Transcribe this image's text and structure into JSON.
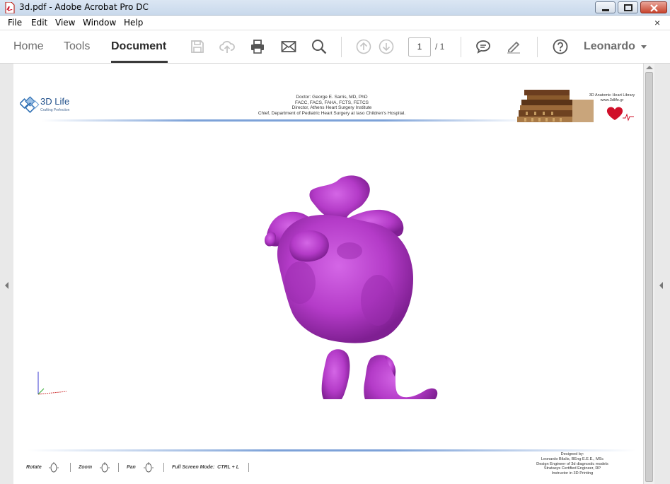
{
  "window": {
    "title": "3d.pdf - Adobe Acrobat Pro DC"
  },
  "menubar": {
    "items": [
      "File",
      "Edit",
      "View",
      "Window",
      "Help"
    ],
    "close_glyph": "×"
  },
  "toolbar": {
    "tabs": [
      {
        "label": "Home",
        "active": false
      },
      {
        "label": "Tools",
        "active": false
      },
      {
        "label": "Document",
        "active": true
      }
    ],
    "page_current": "1",
    "page_total": "/ 1",
    "user_name": "Leonardo",
    "icons": [
      "save-icon",
      "upload-icon",
      "print-icon",
      "email-icon",
      "search-icon",
      "page-up-icon",
      "page-down-icon",
      "comment-icon",
      "sign-icon",
      "help-icon"
    ]
  },
  "document": {
    "logo_text": "3D Life",
    "logo_tagline": "Crafting Perfection",
    "doctor_lines": [
      "Doctor: George E. Sarris, MD, PhD",
      "FACC, FACS, FAHA, FCTS, FETCS",
      "Director, Athens Heart Surgery Institute",
      "Chief, Department of Pediatric Heart Surgery at Iaso Children's Hospital."
    ],
    "library_title": "3D Anatomic Heart Library",
    "library_url": "www.3dlife.gr",
    "model_color": "#b43bc8",
    "footer_controls": [
      {
        "label": "Rotate"
      },
      {
        "label": "Zoom"
      },
      {
        "label": "Pan"
      },
      {
        "label": "Full Screen Mode:  CTRL + L"
      }
    ],
    "designed_lines": [
      "Designed by:",
      "Leonardo Bilalis, BEng E.E.E., MSc",
      "Design Engineer of 3d diagnostic models",
      "Stratasys Certified Engineer, RP",
      "Instructor in 3D Printing"
    ]
  },
  "colors": {
    "accent": "#2a2a2a",
    "rule_blue": "#7da2d8",
    "heart_red": "#d0102a"
  }
}
